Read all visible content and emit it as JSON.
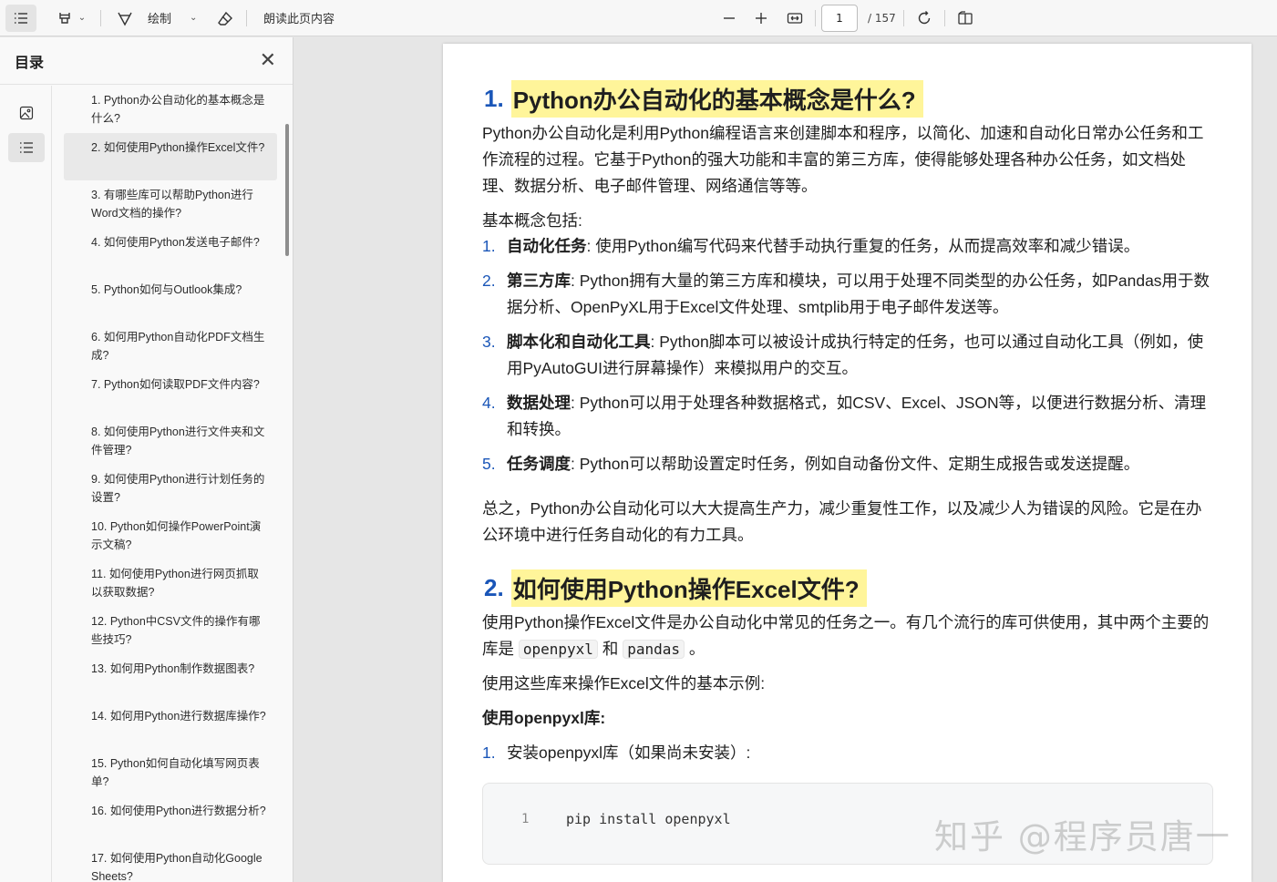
{
  "toolbar": {
    "draw_label": "绘制",
    "read_aloud_label": "朗读此页内容",
    "page_current": "1",
    "page_total": "/ 157"
  },
  "sidebar": {
    "title": "目录",
    "items": [
      "1. Python办公自动化的基本概念是什么?",
      "2. 如何使用Python操作Excel文件?",
      "3. 有哪些库可以帮助Python进行Word文档的操作?",
      "4. 如何使用Python发送电子邮件?",
      "5. Python如何与Outlook集成?",
      "6. 如何用Python自动化PDF文档生成?",
      "7. Python如何读取PDF文件内容?",
      "8. 如何使用Python进行文件夹和文件管理?",
      "9. 如何使用Python进行计划任务的设置?",
      "10. Python如何操作PowerPoint演示文稿?",
      "11. 如何使用Python进行网页抓取以获取数据?",
      "12. Python中CSV文件的操作有哪些技巧?",
      "13. 如何用Python制作数据图表?",
      "14. 如何用Python进行数据库操作?",
      "15. Python如何自动化填写网页表单?",
      "16. 如何使用Python进行数据分析?",
      "17. 如何使用Python自动化Google Sheets?"
    ]
  },
  "doc": {
    "h1_num": "1.",
    "h1_text": "Python办公自动化的基本概念是什么?",
    "p1": "Python办公自动化是利用Python编程语言来创建脚本和程序，以简化、加速和自动化日常办公任务和工作流程的过程。它基于Python的强大功能和丰富的第三方库，使得能够处理各种办公任务，如文档处理、数据分析、电子邮件管理、网络通信等等。",
    "p2": "基本概念包括:",
    "list1": [
      {
        "n": "1.",
        "b": "自动化任务",
        "t": ": 使用Python编写代码来代替手动执行重复的任务，从而提高效率和减少错误。"
      },
      {
        "n": "2.",
        "b": "第三方库",
        "t": ": Python拥有大量的第三方库和模块，可以用于处理不同类型的办公任务，如Pandas用于数据分析、OpenPyXL用于Excel文件处理、smtplib用于电子邮件发送等。"
      },
      {
        "n": "3.",
        "b": "脚本化和自动化工具",
        "t": ": Python脚本可以被设计成执行特定的任务，也可以通过自动化工具（例如，使用PyAutoGUI进行屏幕操作）来模拟用户的交互。"
      },
      {
        "n": "4.",
        "b": "数据处理",
        "t": ": Python可以用于处理各种数据格式，如CSV、Excel、JSON等，以便进行数据分析、清理和转换。"
      },
      {
        "n": "5.",
        "b": "任务调度",
        "t": ": Python可以帮助设置定时任务，例如自动备份文件、定期生成报告或发送提醒。"
      }
    ],
    "p3": "总之，Python办公自动化可以大大提高生产力，减少重复性工作，以及减少人为错误的风险。它是在办公环境中进行任务自动化的有力工具。",
    "h2_num": "2.",
    "h2_text": "如何使用Python操作Excel文件?",
    "p4_a": "使用Python操作Excel文件是办公自动化中常见的任务之一。有几个流行的库可供使用，其中两个主要的库是",
    "p4_code1": "openpyxl",
    "p4_and": "和",
    "p4_code2": "pandas",
    "p4_end": "。",
    "p5": "使用这些库来操作Excel文件的基本示例:",
    "p6": "使用openpyxl库:",
    "li_install_num": "1.",
    "li_install": "安装openpyxl库（如果尚未安装）:",
    "code_line_no": "1",
    "code_text": "pip install openpyxl"
  },
  "watermark": "知乎 @程序员唐一"
}
